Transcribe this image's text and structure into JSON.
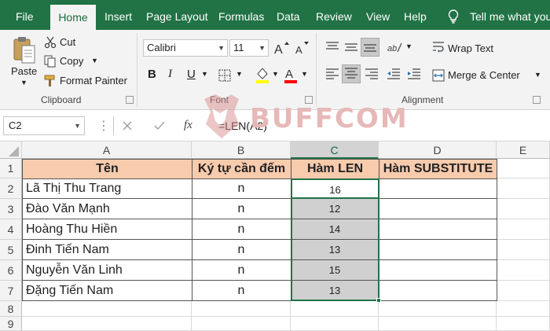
{
  "tabs": [
    {
      "label": "File"
    },
    {
      "label": "Home"
    },
    {
      "label": "Insert"
    },
    {
      "label": "Page Layout"
    },
    {
      "label": "Formulas"
    },
    {
      "label": "Data"
    },
    {
      "label": "Review"
    },
    {
      "label": "View"
    },
    {
      "label": "Help"
    }
  ],
  "tell_me": "Tell me what you",
  "clipboard": {
    "paste": "Paste",
    "cut": "Cut",
    "copy": "Copy",
    "format_painter": "Format Painter",
    "label": "Clipboard"
  },
  "font": {
    "name": "Calibri",
    "size": "11",
    "label": "Font"
  },
  "alignment": {
    "wrap_text": "Wrap Text",
    "merge_center": "Merge & Center",
    "label": "Alignment"
  },
  "formula_bar": {
    "name_box": "C2",
    "fx": "fx",
    "formula": "=LEN(A2)"
  },
  "watermark": "BUFFCOM",
  "columns": [
    "A",
    "B",
    "C",
    "D",
    "E"
  ],
  "rows": [
    "1",
    "2",
    "3",
    "4",
    "5",
    "6",
    "7",
    "8",
    "9"
  ],
  "table": {
    "headers": [
      "Tên",
      "Ký tự cần đếm",
      "Hàm LEN",
      "Hàm SUBSTITUTE"
    ],
    "rows": [
      {
        "name": "Lã Thị Thu Trang",
        "char": "n",
        "len": "16"
      },
      {
        "name": "Đào Văn Mạnh",
        "char": "n",
        "len": "12"
      },
      {
        "name": "Hoàng Thu Hiền",
        "char": "n",
        "len": "14"
      },
      {
        "name": "Đinh Tiến Nam",
        "char": "n",
        "len": "13"
      },
      {
        "name": "Nguyễn Văn Linh",
        "char": "n",
        "len": "15"
      },
      {
        "name": "Đặng Tiến Nam",
        "char": "n",
        "len": "13"
      }
    ]
  },
  "colors": {
    "ribbon_green": "#217346",
    "header_fill": "#f8cbad",
    "selection_gray": "#d0d0d0"
  }
}
